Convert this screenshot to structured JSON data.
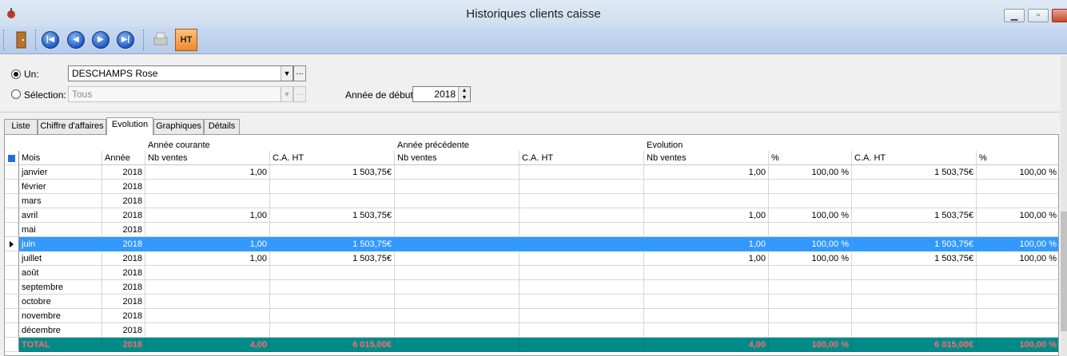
{
  "window": {
    "title": "Historiques clients caisse"
  },
  "toolbar": {
    "ht_label": "HT",
    "first_glyph": "|◀",
    "prev_glyph": "◀",
    "next_glyph": "▶",
    "last_glyph": "▶|"
  },
  "filters": {
    "un_label": "Un:",
    "un_value": "DESCHAMPS Rose",
    "selection_label": "Sélection:",
    "selection_value": "Tous",
    "dots": "...",
    "annee_label": "Année de début :",
    "annee_value": "2018"
  },
  "tabs": [
    "Liste",
    "Chiffre d'affaires",
    "Evolution",
    "Graphiques",
    "Détails"
  ],
  "active_tab": "Evolution",
  "grid": {
    "group_headers": {
      "courante": "Année courante",
      "precedente": "Année précédente",
      "evolution": "Evolution"
    },
    "columns": [
      "Mois",
      "Année",
      "Nb ventes",
      "C.A. HT",
      "Nb ventes",
      "C.A. HT",
      "Nb ventes",
      "%",
      "C.A. HT",
      "%"
    ],
    "rows": [
      [
        "janvier",
        "2018",
        "1,00",
        "1 503,75€",
        "",
        "",
        "1,00",
        "100,00 %",
        "1 503,75€",
        "100,00 %"
      ],
      [
        "février",
        "2018",
        "",
        "",
        "",
        "",
        "",
        "",
        "",
        ""
      ],
      [
        "mars",
        "2018",
        "",
        "",
        "",
        "",
        "",
        "",
        "",
        ""
      ],
      [
        "avril",
        "2018",
        "1,00",
        "1 503,75€",
        "",
        "",
        "1,00",
        "100,00 %",
        "1 503,75€",
        "100,00 %"
      ],
      [
        "mai",
        "2018",
        "",
        "",
        "",
        "",
        "",
        "",
        "",
        ""
      ],
      [
        "juin",
        "2018",
        "1,00",
        "1 503,75€",
        "",
        "",
        "1,00",
        "100,00 %",
        "1 503,75€",
        "100,00 %"
      ],
      [
        "juillet",
        "2018",
        "1,00",
        "1 503,75€",
        "",
        "",
        "1,00",
        "100,00 %",
        "1 503,75€",
        "100,00 %"
      ],
      [
        "août",
        "2018",
        "",
        "",
        "",
        "",
        "",
        "",
        "",
        ""
      ],
      [
        "septembre",
        "2018",
        "",
        "",
        "",
        "",
        "",
        "",
        "",
        ""
      ],
      [
        "octobre",
        "2018",
        "",
        "",
        "",
        "",
        "",
        "",
        "",
        ""
      ],
      [
        "novembre",
        "2018",
        "",
        "",
        "",
        "",
        "",
        "",
        "",
        ""
      ],
      [
        "décembre",
        "2018",
        "",
        "",
        "",
        "",
        "",
        "",
        "",
        ""
      ]
    ],
    "selected_row": 5,
    "total": [
      "TOTAL",
      "2018",
      "4,00",
      "6 015,00€",
      "",
      "",
      "4,00",
      "100,00 %",
      "6 015,00€",
      "100,00 %"
    ]
  }
}
